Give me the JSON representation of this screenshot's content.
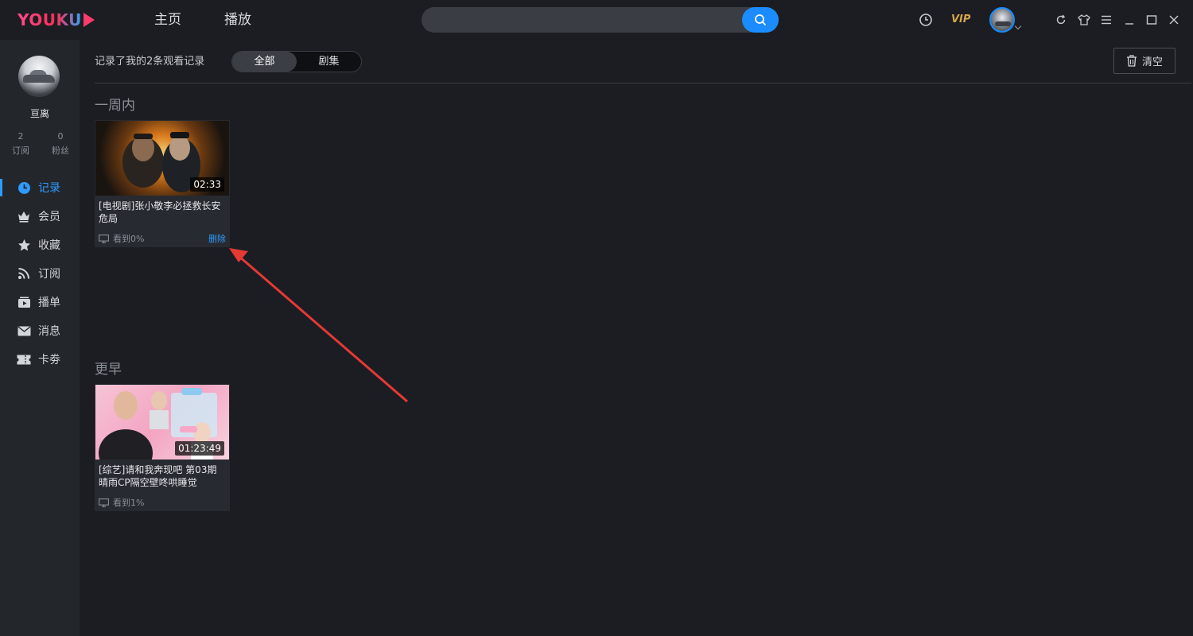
{
  "app": {
    "logo_text": "YOUKU",
    "accent": "#1a8cff",
    "brand": "#ff2d55"
  },
  "topbar": {
    "nav": [
      "主页",
      "播放"
    ],
    "vip_label": "VIP",
    "icons": [
      "history-icon",
      "refresh-icon",
      "skin-icon",
      "menu-icon",
      "minimize-icon",
      "maximize-icon",
      "close-icon"
    ]
  },
  "sidebar": {
    "username": "亘离",
    "stats": [
      {
        "value": "2",
        "label": "订阅"
      },
      {
        "value": "0",
        "label": "粉丝"
      }
    ],
    "items": [
      {
        "label": "记录",
        "icon": "clock-icon",
        "active": true
      },
      {
        "label": "会员",
        "icon": "crown-icon",
        "active": false
      },
      {
        "label": "收藏",
        "icon": "star-icon",
        "active": false
      },
      {
        "label": "订阅",
        "icon": "rss-icon",
        "active": false
      },
      {
        "label": "播单",
        "icon": "playlist-icon",
        "active": false
      },
      {
        "label": "消息",
        "icon": "mail-icon",
        "active": false
      },
      {
        "label": "卡劵",
        "icon": "ticket-icon",
        "active": false
      }
    ]
  },
  "main": {
    "summary": "记录了我的2条观看记录",
    "tabs": [
      {
        "label": "全部",
        "active": true
      },
      {
        "label": "剧集",
        "active": false
      }
    ],
    "clear_label": "清空",
    "sections": [
      {
        "title": "一周内",
        "cards": [
          {
            "title": "[电视剧]张小敬李必拯救长安危局",
            "duration": "02:33",
            "progress": "看到0%",
            "delete": "删除"
          }
        ]
      },
      {
        "title": "更早",
        "cards": [
          {
            "title": "[综艺]请和我奔现吧 第03期 晴雨CP隔空壁咚哄睡觉",
            "duration": "01:23:49",
            "progress": "看到1%"
          }
        ]
      }
    ]
  }
}
